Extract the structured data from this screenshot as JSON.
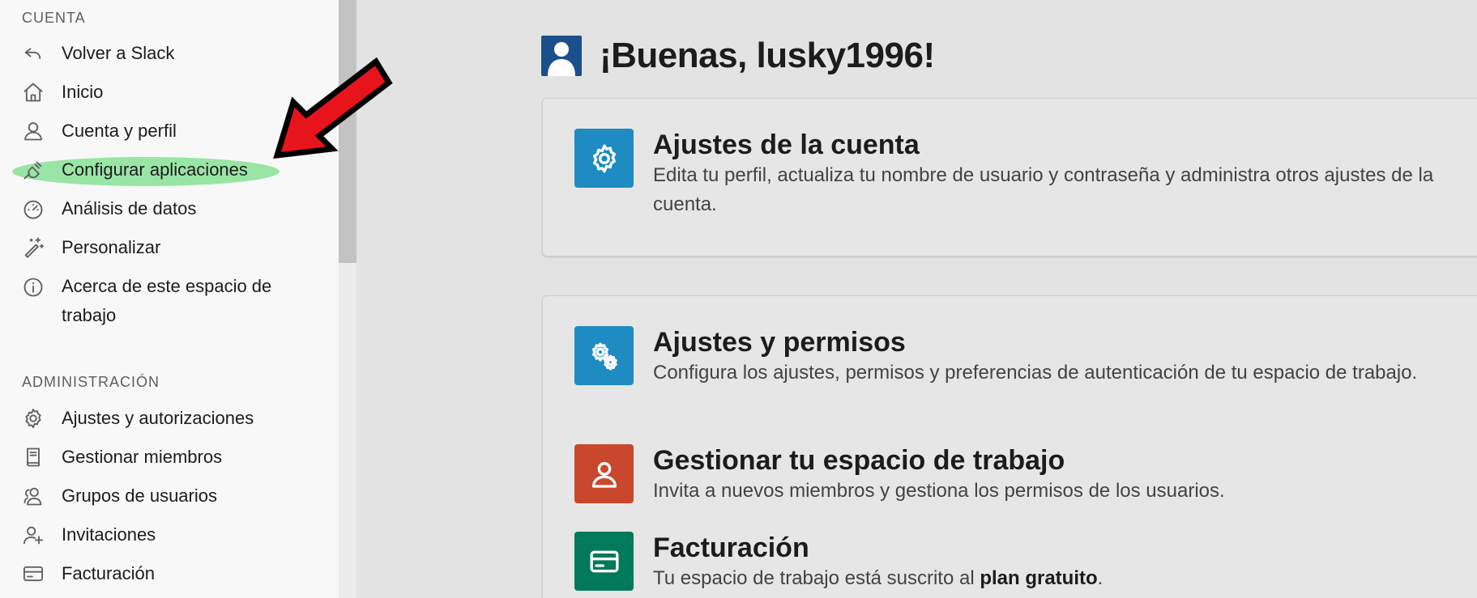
{
  "sidebar": {
    "account_section": "CUENTA",
    "account_items": [
      {
        "label": "Volver a Slack",
        "icon": "back-arrow-icon"
      },
      {
        "label": "Inicio",
        "icon": "home-icon"
      },
      {
        "label": "Cuenta y perfil",
        "icon": "user-icon"
      },
      {
        "label": "Configurar aplicaciones",
        "icon": "plug-icon"
      },
      {
        "label": "Análisis de datos",
        "icon": "gauge-icon"
      },
      {
        "label": "Personalizar",
        "icon": "magic-wand-icon"
      },
      {
        "label": "Acerca de este espacio de trabajo",
        "icon": "info-icon"
      }
    ],
    "admin_section": "ADMINISTRACIÓN",
    "admin_items": [
      {
        "label": "Ajustes y autorizaciones",
        "icon": "gear-icon"
      },
      {
        "label": "Gestionar miembros",
        "icon": "book-icon"
      },
      {
        "label": "Grupos de usuarios",
        "icon": "users-icon"
      },
      {
        "label": "Invitaciones",
        "icon": "user-add-icon"
      },
      {
        "label": "Facturación",
        "icon": "card-icon"
      }
    ]
  },
  "main": {
    "greeting": "¡Buenas, lusky1996!",
    "cards": [
      {
        "title": "Ajustes de la cuenta",
        "description": "Edita tu perfil, actualiza tu nombre de usuario y contraseña y administra otros ajustes de la cuenta.",
        "icon": "gear-icon",
        "color": "#1e8bc3"
      },
      {
        "title": "Ajustes y permisos",
        "description": "Configura los ajustes, permisos y preferencias de autenticación de tu espacio de trabajo.",
        "icon": "gears-icon",
        "color": "#1e8bc3"
      },
      {
        "title": "Gestionar tu espacio de trabajo",
        "description": "Invita a nuevos miembros y gestiona los permisos de los usuarios.",
        "icon": "user-icon",
        "color": "#c9472c"
      },
      {
        "title": "Facturación",
        "description_prefix": "Tu espacio de trabajo está suscrito al ",
        "description_bold": "plan gratuito",
        "description_suffix": ".",
        "icon": "card-icon",
        "color": "#007a5a"
      }
    ]
  },
  "colors": {
    "highlight": "#8ee29b",
    "arrow": "#e8141c",
    "avatar": "#1a4f8b"
  }
}
